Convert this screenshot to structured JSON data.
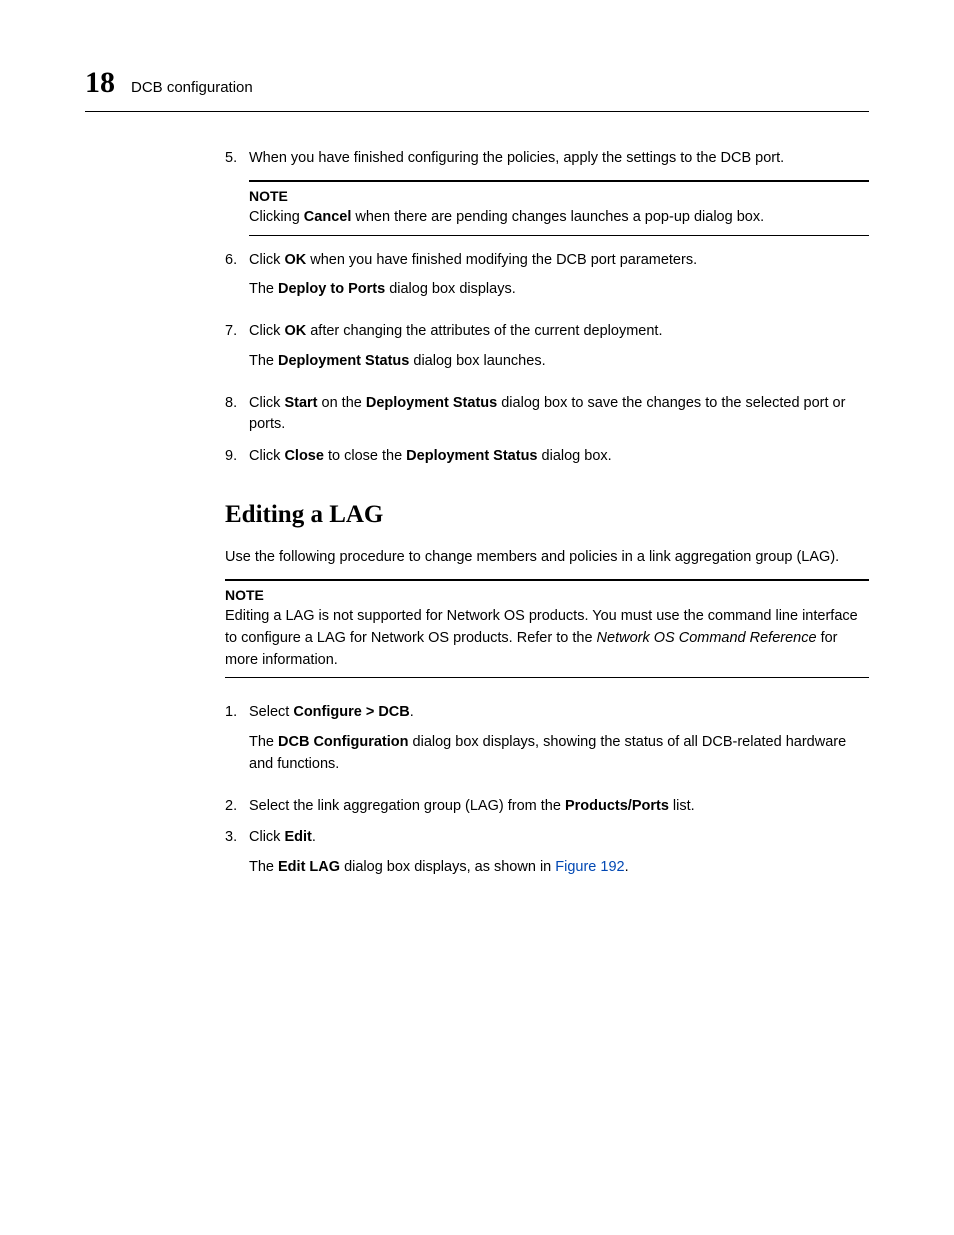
{
  "header": {
    "chapter_number": "18",
    "chapter_title": "DCB configuration"
  },
  "steps_top": {
    "s5": {
      "num": "5.",
      "text": "When you have finished configuring the policies, apply the settings to the DCB port."
    },
    "note1": {
      "label": "NOTE",
      "pre": "Clicking ",
      "bold": "Cancel",
      "post": " when there are pending changes launches a pop-up dialog box."
    },
    "s6": {
      "num": "6.",
      "pre": "Click ",
      "bold": "OK",
      "post": " when you have finished modifying the DCB port parameters.",
      "sub_pre": "The ",
      "sub_bold": "Deploy to Ports",
      "sub_post": " dialog box displays."
    },
    "s7": {
      "num": "7.",
      "pre": "Click ",
      "bold": "OK",
      "post": " after changing the attributes of the current deployment.",
      "sub_pre": "The ",
      "sub_bold": "Deployment Status",
      "sub_post": " dialog box launches."
    },
    "s8": {
      "num": "8.",
      "pre": "Click ",
      "bold1": "Start",
      "mid": " on the ",
      "bold2": "Deployment Status",
      "post": " dialog box to save the changes to the selected port or ports."
    },
    "s9": {
      "num": "9.",
      "pre": "Click ",
      "bold1": "Close",
      "mid": " to close the ",
      "bold2": "Deployment Status",
      "post": " dialog box."
    }
  },
  "section": {
    "heading": "Editing a LAG",
    "intro": "Use the following procedure to change members and policies in a link aggregation group (LAG).",
    "note": {
      "label": "NOTE",
      "pre": "Editing a LAG is not supported for Network OS products. You must use the command line interface to configure a LAG for Network OS products. Refer to the ",
      "italic": "Network OS Command Reference",
      "post": " for more information."
    },
    "s1": {
      "num": "1.",
      "pre": "Select ",
      "bold": "Configure > DCB",
      "post": ".",
      "sub_pre": "The ",
      "sub_bold": "DCB Configuration",
      "sub_post": " dialog box displays, showing the status of all DCB-related hardware and functions."
    },
    "s2": {
      "num": "2.",
      "pre": "Select the link aggregation group (LAG) from the ",
      "bold": "Products/Ports",
      "post": " list."
    },
    "s3": {
      "num": "3.",
      "pre": "Click ",
      "bold": "Edit",
      "post": ".",
      "sub_pre": "The ",
      "sub_bold": "Edit LAG",
      "sub_mid": " dialog box displays, as shown in ",
      "sub_link": "Figure 192",
      "sub_post": "."
    }
  }
}
